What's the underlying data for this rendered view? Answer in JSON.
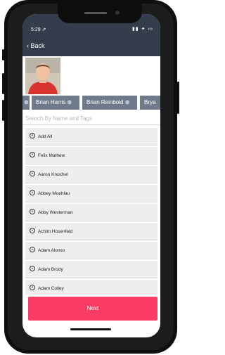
{
  "status_bar": {
    "time": "5:29 ⇗",
    "icons": "▮▮ ✦ ▭"
  },
  "nav": {
    "back_label": "‹ Back"
  },
  "profile": {
    "photo_icon": "person-photo"
  },
  "chips": [
    {
      "label": "⊗"
    },
    {
      "label": "Brian  Harris ⊗"
    },
    {
      "label": "Brian  Reinbold ⊗"
    },
    {
      "label": "Brya"
    }
  ],
  "search": {
    "placeholder": "Search By Name and Tags",
    "value": ""
  },
  "list": {
    "items": [
      {
        "label": "Add All"
      },
      {
        "label": "Felix  Mathew"
      },
      {
        "label": "Aaron  Knochel"
      },
      {
        "label": "Abbey  Moehlau"
      },
      {
        "label": "Abby  Westerman"
      },
      {
        "label": "Achim  Hosenfeld"
      },
      {
        "label": "Adam  Alonso"
      },
      {
        "label": "Adam  Brody"
      },
      {
        "label": "Adam  Colley"
      }
    ]
  },
  "footer": {
    "next_label": "Next"
  },
  "colors": {
    "appbar": "#343d4c",
    "chip": "#6f7b8a",
    "accent": "#fa3b63",
    "row": "#eeeeee"
  }
}
